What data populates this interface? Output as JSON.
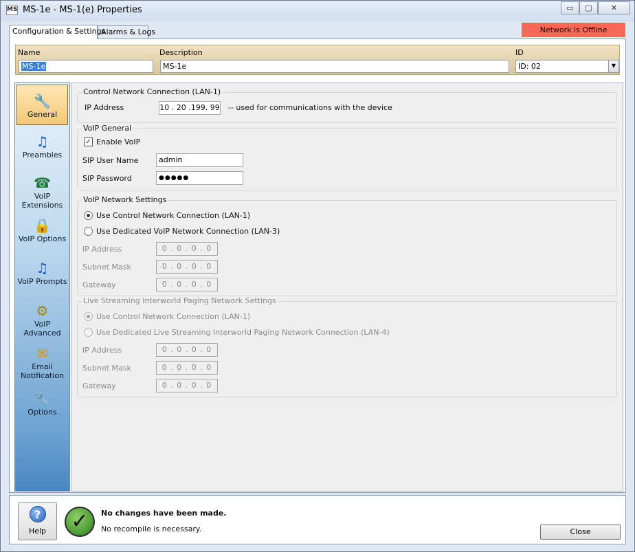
{
  "window": {
    "app_icon": "MS",
    "title": "MS-1e - MS-1(e) Properties",
    "buttons": {
      "minimize": "▭",
      "maximize": "▢",
      "close": "✕"
    }
  },
  "tabs": [
    {
      "label": "Configuration & Settings",
      "active": true
    },
    {
      "label": "Alarms & Logs",
      "active": false
    }
  ],
  "status_banner": {
    "text": "Network is Offline",
    "color": "#f36b58"
  },
  "header": {
    "name_label": "Name",
    "name_value": "MS-1e",
    "description_label": "Description",
    "description_value": "MS-1e",
    "id_label": "ID",
    "id_value": "ID: 02"
  },
  "nav": {
    "items": [
      {
        "label": "General",
        "icon": "wrench-icon",
        "selected": true
      },
      {
        "label": "Preambles",
        "icon": "music-note-icon"
      },
      {
        "label": "VoIP Extensions",
        "icon": "phone-globe-icon"
      },
      {
        "label": "VoIP Options",
        "icon": "lock-icon"
      },
      {
        "label": "VoIP Prompts",
        "icon": "music-note-icon"
      },
      {
        "label": "VoIP Advanced",
        "icon": "gear-icon"
      },
      {
        "label": "Email Notification",
        "icon": "envelope-icon"
      },
      {
        "label": "Options",
        "icon": "wrench-icon"
      }
    ]
  },
  "control_network": {
    "title": "Control Network Connection (LAN-1)",
    "ip_label": "IP Address",
    "ip_value": "10 . 20 .199. 99",
    "ip_note": "-- used for communications with the device"
  },
  "voip_general": {
    "title": "VoIP General",
    "enable_label": "Enable VoIP",
    "enable_checked": true,
    "sip_user_label": "SIP User Name",
    "sip_user_value": "admin",
    "sip_password_label": "SIP Password",
    "sip_password_value": "●●●●●"
  },
  "voip_network": {
    "title": "VoIP Network Settings",
    "option_control": "Use Control Network Connection (LAN-1)",
    "option_dedicated": "Use Dedicated VoIP Network Connection (LAN-3)",
    "selected": "control",
    "ip_label": "IP Address",
    "subnet_label": "Subnet Mask",
    "gateway_label": "Gateway",
    "ip_value": "0 . 0 . 0 . 0",
    "subnet_value": "0 . 0 . 0 . 0",
    "gateway_value": "0 . 0 . 0 . 0"
  },
  "live_streaming": {
    "title": "Live Streaming Interworld Paging Network Settings",
    "option_control": "Use Control Network Connection (LAN-1)",
    "option_dedicated": "Use Dedicated Live Streaming Interworld Paging Network Connection (LAN-4)",
    "selected": "control",
    "ip_label": "IP Address",
    "subnet_label": "Subnet Mask",
    "gateway_label": "Gateway",
    "ip_value": "0 . 0 . 0 . 0",
    "subnet_value": "0 . 0 . 0 . 0",
    "gateway_value": "0 . 0 . 0 . 0"
  },
  "footer": {
    "help_label": "Help",
    "help_icon": "?",
    "status_icon": "✓",
    "status_title": "No changes have been made.",
    "status_detail": "No recompile is necessary.",
    "close_label": "Close"
  }
}
